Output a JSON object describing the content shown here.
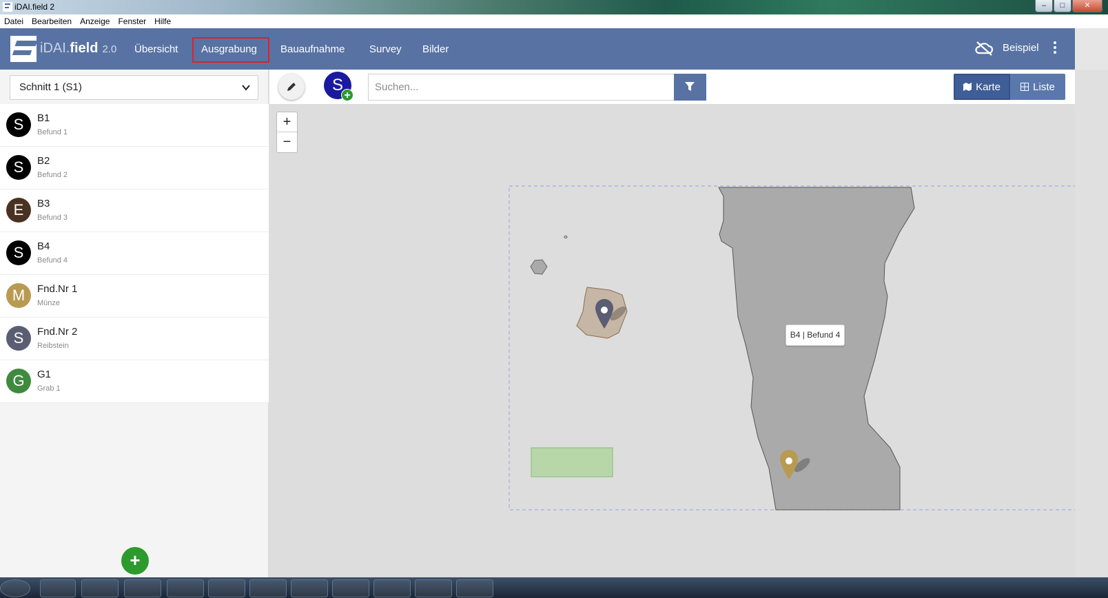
{
  "window": {
    "title": "iDAI.field 2",
    "controls": {
      "minimize": "–",
      "maximize": "□",
      "close": "✕"
    }
  },
  "menubar": [
    "Datei",
    "Bearbeiten",
    "Anzeige",
    "Fenster",
    "Hilfe"
  ],
  "app": {
    "logo_light": "iDAI.",
    "logo_bold": "field",
    "version": "2.0",
    "nav": [
      "Übersicht",
      "Ausgrabung",
      "Bauaufnahme",
      "Survey",
      "Bilder"
    ],
    "active_nav": "Ausgrabung",
    "project": "Beispiel"
  },
  "sidebar": {
    "selected_trench": "Schnitt 1 (S1)",
    "items": [
      {
        "letter": "S",
        "title": "B1",
        "subtitle": "Befund 1",
        "color": "#000000"
      },
      {
        "letter": "S",
        "title": "B2",
        "subtitle": "Befund 2",
        "color": "#000000"
      },
      {
        "letter": "E",
        "title": "B3",
        "subtitle": "Befund 3",
        "color": "#4a3222"
      },
      {
        "letter": "S",
        "title": "B4",
        "subtitle": "Befund 4",
        "color": "#000000"
      },
      {
        "letter": "M",
        "title": "Fnd.Nr 1",
        "subtitle": "Münze",
        "color": "#b89a52"
      },
      {
        "letter": "S",
        "title": "Fnd.Nr 2",
        "subtitle": "Reibstein",
        "color": "#5b5d73"
      },
      {
        "letter": "G",
        "title": "G1",
        "subtitle": "Grab 1",
        "color": "#3f8a3f"
      }
    ],
    "add_label": "+"
  },
  "toolbar": {
    "new_type_letter": "S",
    "new_plus": "+",
    "search_placeholder": "Suchen...",
    "view_map": "Karte",
    "view_list": "Liste"
  },
  "map": {
    "zoom_in": "+",
    "zoom_out": "−",
    "tooltip": "B4 | Befund 4"
  },
  "colors": {
    "navbar": "#5873a3",
    "accent_green": "#2d9a2d",
    "active_outline": "#e0202a"
  }
}
